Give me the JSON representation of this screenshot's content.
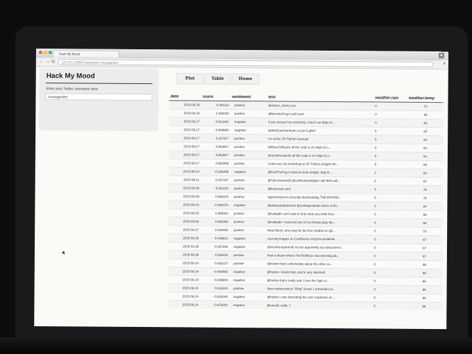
{
  "browser": {
    "tab_title": "Hack My Mood",
    "url": "127.0.0.1:8050/?username=musegarden",
    "back": "←",
    "forward": "→",
    "reload": "↻",
    "menu": "≡",
    "colors": {
      "close": "#ff5f57",
      "minimize": "#ffbd2e",
      "maximize": "#28c940"
    }
  },
  "sidebar": {
    "title": "Hack My Mood",
    "username_label": "Enter your Twitter username here:",
    "username_value": "musegarden"
  },
  "nav": {
    "plot": "Plot",
    "table": "Table",
    "home": "Home"
  },
  "table": {
    "headers": [
      "date",
      "score",
      "sentiment",
      "text",
      "weather.rain",
      "weather.temp"
    ],
    "rows": [
      [
        "2015-09-19",
        "0.301112",
        "positive",
        "@alison_cherry yes",
        "0",
        "70"
      ],
      [
        "2015-09-18",
        "0.389429",
        "positive",
        "@blenderhil get well soon",
        "0",
        "68"
      ],
      [
        "2015-09-17",
        "-0.012291",
        "negative",
        "If you missed my workshop, check out https://t...",
        "0",
        "64"
      ],
      [
        "2015-09-17",
        "-0.508600",
        "negative",
        "@whoCanSamhoan is just a glitch",
        "0",
        "64"
      ],
      [
        "2015-09-17",
        "0.327217",
        "positive",
        "I'm at the SF Python meetup!",
        "0",
        "64"
      ],
      [
        "2015-09-17",
        "0.663927",
        "positive",
        "@BlueChillLabs all the code is on https://t.c...",
        "0",
        "64"
      ],
      [
        "2015-09-17",
        "0.663927",
        "positive",
        "@sushimusterite all the code is on https://t.c...",
        "0",
        "64"
      ],
      [
        "2015-09-17",
        "0.602006",
        "positive",
        "Come see my workshop at SF Python tonight! htt...",
        "0",
        "64"
      ],
      [
        "2015-09-14",
        "-0.306298",
        "negative",
        "@KarlTheFog is hard at work tonight. http://t....",
        "1",
        "63"
      ],
      [
        "2015-09-11",
        "0.497197",
        "positive",
        "@TylerJones429 @coffeeatmidnight I will 90% will...",
        "0",
        "67"
      ],
      [
        "2015-09-09",
        "0.501104",
        "positive",
        "@kriyeesee yes!",
        "0",
        "76"
      ],
      [
        "2015-09-09",
        "0.590678",
        "positive",
        "#getonmylevel currently downloading THE ENTIRE...",
        "0",
        "76"
      ],
      [
        "2015-09-03",
        "-0.364078",
        "negative",
        "@adarsandadorison @sunilapsstarde where is lfo...",
        "0",
        "84"
      ],
      [
        "2015-09-02",
        "0.465921",
        "positive",
        "@cadaallv can't wait to hear what you think then",
        "0",
        "68"
      ],
      [
        "2015-09-02",
        "0.094303",
        "positive",
        "@cadaallv I watched one of my friends play the...",
        "0",
        "68"
      ],
      [
        "2015-08-27",
        "0.494488",
        "positive",
        "Meet Meryl, who may be the first chatbot on @i...",
        "0",
        "74"
      ],
      [
        "2015-08-26",
        "-0.446831",
        "negative",
        "resizing images on Confluence #myPersonalHell ...",
        "0",
        "67"
      ],
      [
        "2015-08-26",
        "-0.807384",
        "negative",
        "@moshenoparendr no but apparently my autocorrect...",
        "0",
        "67"
      ],
      [
        "2015-08-26",
        "0.536420",
        "positive",
        "Had a dream where Pat Rothfuss was tweeting ab...",
        "0",
        "67"
      ],
      [
        "2015-08-24",
        "0.853127",
        "positive",
        "@hutton that's unfortunate about the other co...",
        "0",
        "66"
      ],
      [
        "2015-08-24",
        "-0.400085",
        "negative",
        "@hutton I doubt that, you're very talented!",
        "0",
        "66"
      ],
      [
        "2015-08-24",
        "-0.258809",
        "negative",
        "@hutton that's really sad. I love the high co...",
        "0",
        "66"
      ],
      [
        "2015-08-24",
        "0.515242",
        "positive",
        "New mathematical \"Sling\" found. I remember pl...",
        "0",
        "66"
      ],
      [
        "2015-08-24",
        "-0.543168",
        "negative",
        "@hutton I was lamenting the over emphasis on ...",
        "0",
        "66"
      ],
      [
        "2015-08-24",
        "-0.878204",
        "negative",
        "@emsd2 sadly :(",
        "0",
        "66"
      ]
    ]
  }
}
